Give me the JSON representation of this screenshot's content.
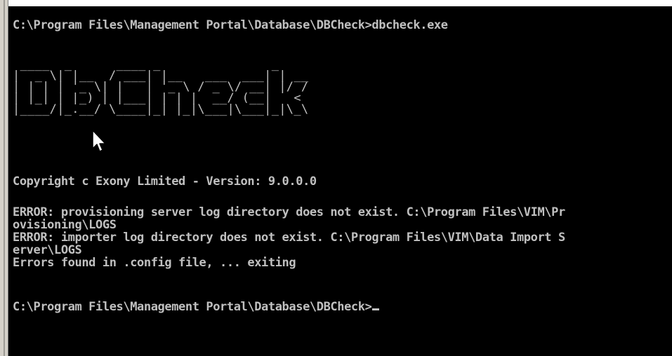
{
  "console": {
    "command_line": "C:\\Program Files\\Management Portal\\Database\\DBCheck>dbcheck.exe",
    "banner_art": [
      " ____  _      ____ _               _",
      "|  _ \\| |__  / ___| |__   ___  ___| | __",
      "| | | | '_ \\| |   | '_ \\ / _ \\/ __| |/ /",
      "| |_| | |_) | |___| | | |  __/ (__|   <",
      "|____/|_.__/ \\____|_| |_|\\___|\\___|_|\\_\\"
    ],
    "copyright": "Copyright c Exony Limited - Version: 9.0.0.0",
    "errors": [
      "ERROR: provisioning server log directory does not exist. C:\\Program Files\\VIM\\Pr",
      "ovisioning\\LOGS",
      "ERROR: importer log directory does not exist. C:\\Program Files\\VIM\\Data Import S",
      "erver\\LOGS",
      "Errors found in .config file, ... exiting"
    ],
    "prompt": "C:\\Program Files\\Management Portal\\Database\\DBCheck>"
  },
  "colors": {
    "background": "#000000",
    "text": "#c0c0c0",
    "window_border": "#d4d0c8"
  },
  "icons": {
    "pointer": "mouse-pointer-icon"
  }
}
